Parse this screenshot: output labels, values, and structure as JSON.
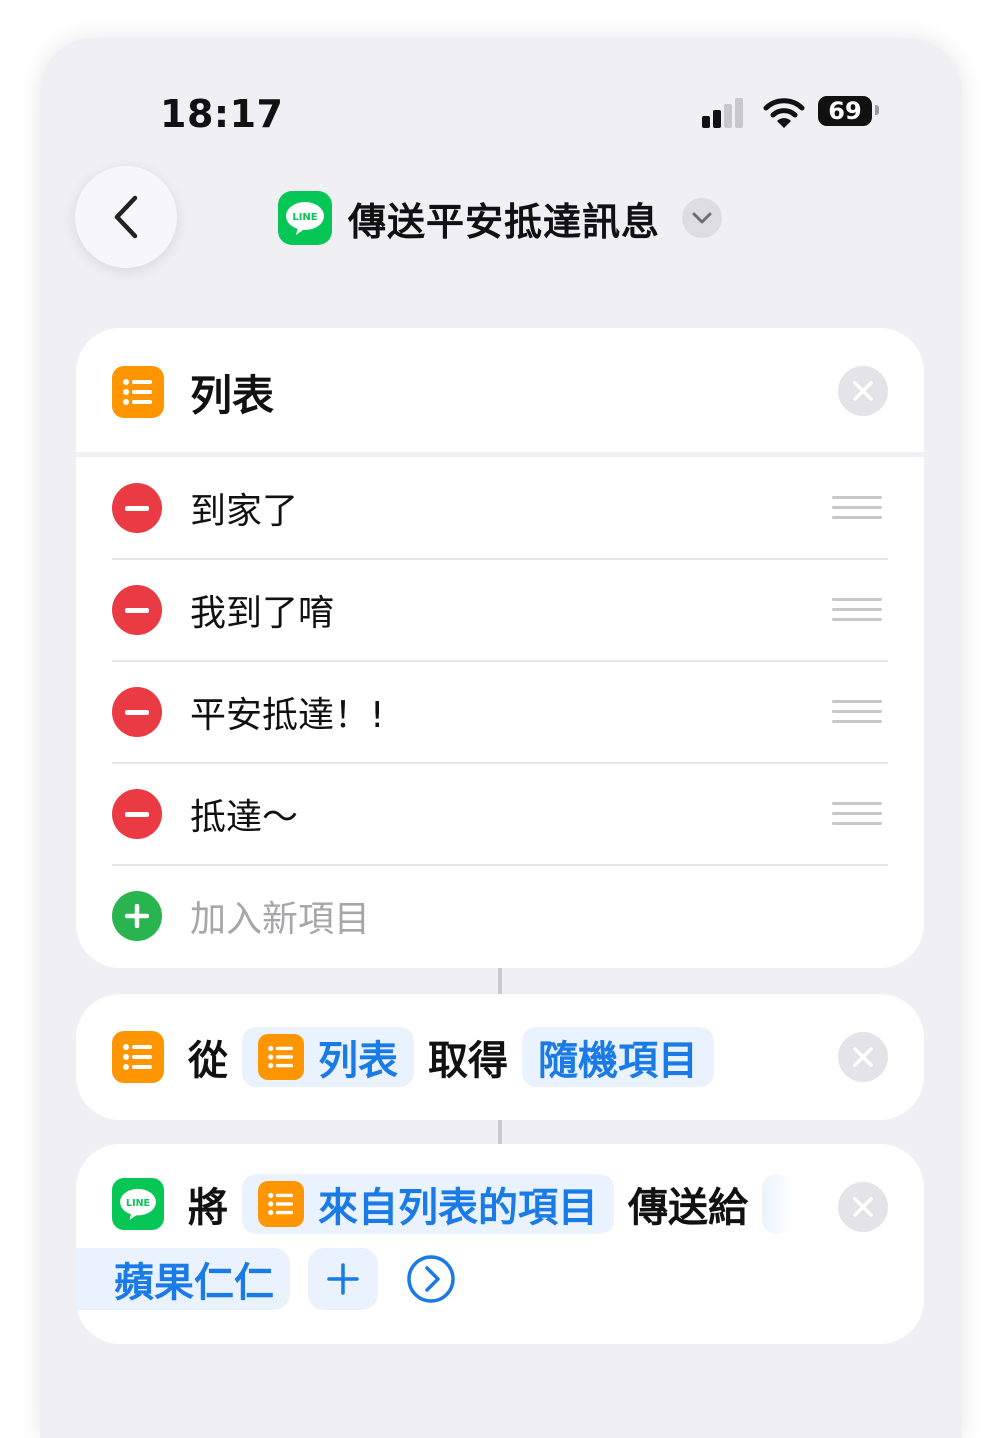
{
  "status_bar": {
    "time": "18:17",
    "battery": "69"
  },
  "nav": {
    "title": "傳送平安抵達訊息",
    "app_icon_text": "LINE"
  },
  "list_action": {
    "title": "列表",
    "items": [
      "到家了",
      "我到了唷",
      "平安抵達！!",
      "抵達～"
    ],
    "add_item_placeholder": "加入新項目"
  },
  "get_item_action": {
    "word_from": "從",
    "list_token": "列表",
    "word_get": "取得",
    "item_token": "隨機項目"
  },
  "send_action": {
    "word_will": "將",
    "item_token": "來自列表的項目",
    "word_send_to": "傳送給",
    "recipient": "蘋果仁仁",
    "add_symbol": "+"
  },
  "colors": {
    "background": "#efeff4",
    "card": "#ffffff",
    "line_green": "#06c755",
    "orange": "#ff9500",
    "accent_blue": "#1a7ae6",
    "delete_red": "#ea3a43",
    "add_green": "#2ab44f"
  },
  "icons": [
    "signal-icon",
    "wifi-icon",
    "battery-icon",
    "back-chevron-icon",
    "line-app-icon",
    "chevron-down-icon",
    "list-icon",
    "close-icon",
    "minus-icon",
    "drag-handle-icon",
    "plus-icon",
    "chevron-right-circle-icon"
  ]
}
